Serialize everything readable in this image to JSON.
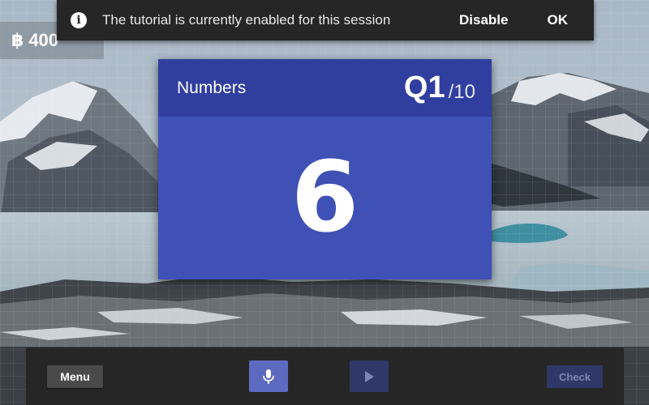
{
  "score": {
    "icon": "baht-coin-icon",
    "symbol": "฿",
    "value": "400"
  },
  "notice": {
    "icon": "info-icon",
    "message": "The tutorial is currently enabled for this session",
    "disable_label": "Disable",
    "ok_label": "OK"
  },
  "question": {
    "category": "Numbers",
    "number": "Q1",
    "total": "/10",
    "prompt": "6"
  },
  "controls": {
    "menu_label": "Menu",
    "mic_icon": "microphone-icon",
    "play_icon": "play-icon",
    "check_label": "Check"
  },
  "colors": {
    "card_header": "#303f9f",
    "card_body": "#3f51b5",
    "mic_button": "#5c6bc0",
    "disabled_button": "#2f3869",
    "bar_background": "#262626"
  }
}
